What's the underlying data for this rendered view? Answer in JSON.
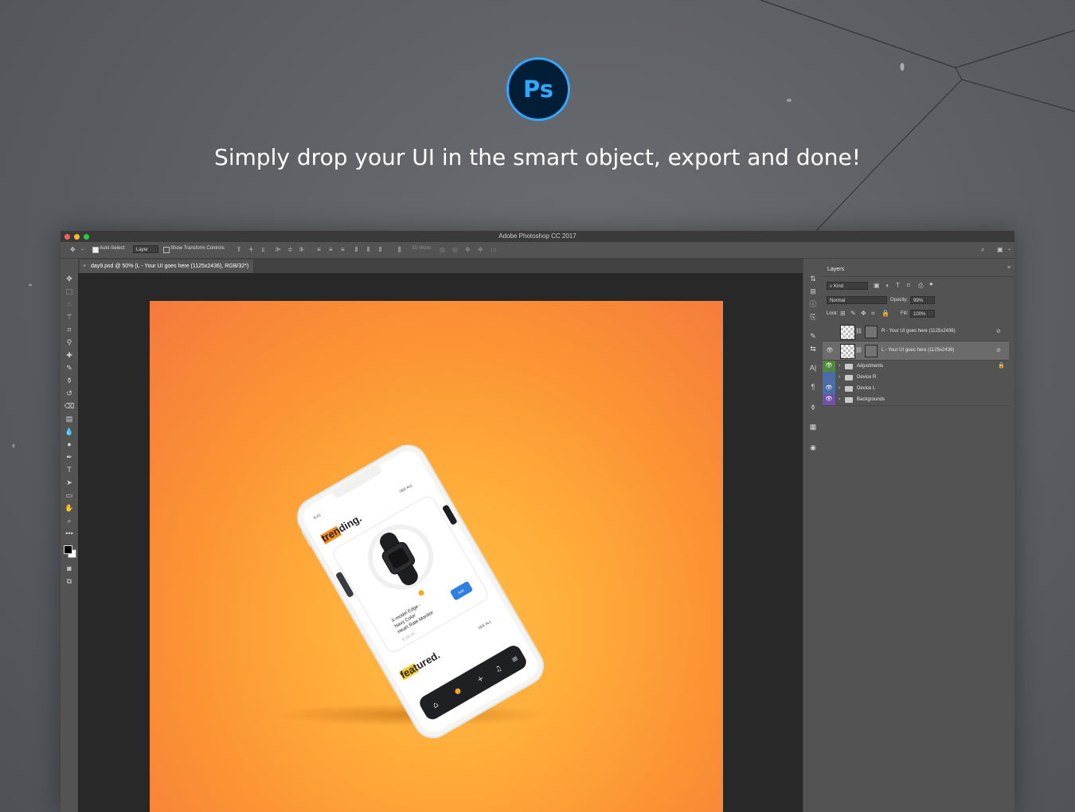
{
  "hero": {
    "logo_text": "Ps",
    "tagline": "Simply drop your UI in the smart object, export and done!"
  },
  "window": {
    "title": "Adobe Photoshop CC 2017",
    "traffic_colors": [
      "#fe5f57",
      "#febb2e",
      "#28c840"
    ]
  },
  "options_bar": {
    "auto_select_label": "Auto-Select:",
    "auto_select_value": "Layer",
    "show_transform_label": "Show Transform Controls",
    "mode_3d_label": "3D Mode:"
  },
  "document_tab": {
    "title": "day9.psd @ 50% (L - Your UI goes here (1125x2436), RGB/32*)"
  },
  "layers_panel": {
    "title": "Layers",
    "filter_kind": "Kind",
    "blend_mode": "Normal",
    "opacity_label": "Opacity:",
    "opacity_value": "99%",
    "lock_label": "Lock:",
    "fill_label": "Fill:",
    "fill_value": "100%",
    "layers": [
      {
        "name": "R - Your UI goes here (1125x2436)",
        "type": "smart",
        "visible": false,
        "selected": false
      },
      {
        "name": "L - Your UI goes here (1125x2436)",
        "type": "smart",
        "visible": true,
        "selected": true
      },
      {
        "name": "Adjustments",
        "type": "group",
        "visible": true,
        "color": "#4f8a3c",
        "locked": true
      },
      {
        "name": "Device R",
        "type": "group",
        "visible": false,
        "color": "#4a6da8"
      },
      {
        "name": "Device L",
        "type": "group",
        "visible": true,
        "color": "#4a6da8"
      },
      {
        "name": "Backgrounds",
        "type": "group",
        "visible": true,
        "color": "#7052a4"
      }
    ]
  },
  "phone": {
    "time": "9:41",
    "trending_title": "trending.",
    "see_all_1": "SEE ALL",
    "product_name": "X-model Edge - Navy Color Heart Rate Monitor",
    "product_line1": "X-model Edge -",
    "product_line2": "Navy Color",
    "product_line3": "Heart Rate Monitor",
    "price": "$ 199.90",
    "add_label": "Add",
    "featured_title": "featured.",
    "see_all_2": "SEE ALL",
    "accent": "#f5a623",
    "button_color": "#2f7fe0"
  }
}
